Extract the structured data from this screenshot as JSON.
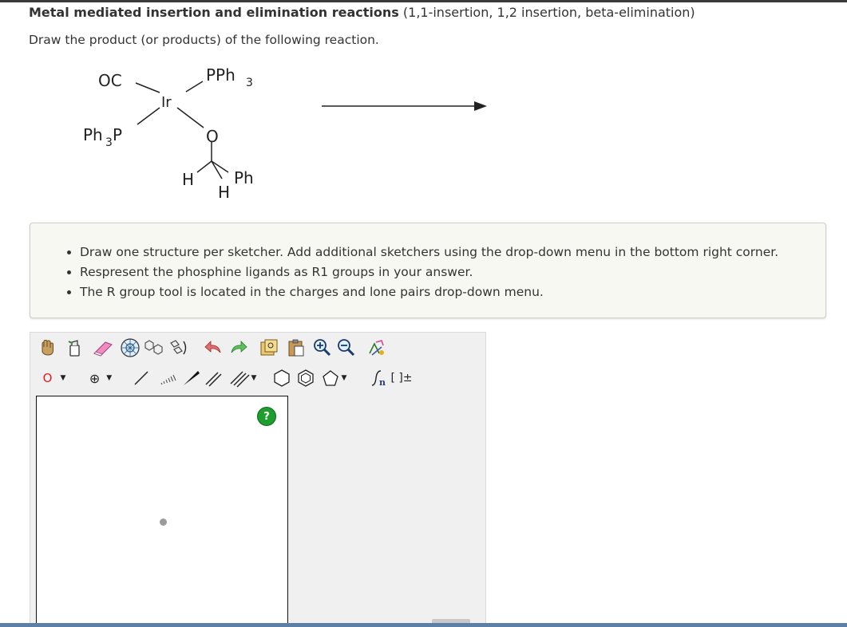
{
  "question": {
    "title_bold": "Metal mediated insertion and elimination reactions",
    "title_rest": " (1,1-insertion, 1,2 insertion, beta-elimination)",
    "instruction": "Draw the product (or products) of the following reaction."
  },
  "molecule": {
    "co": "OC",
    "pph3_top": "PPh",
    "pph3_top_sub": "3",
    "ir": "Ir",
    "ph3p_left": "Ph",
    "ph3p_left_sub": "3",
    "ph3p_left_p": "P",
    "oxygen": "O",
    "h_left": "H",
    "h_bottom": "H",
    "ph": "Ph"
  },
  "info": {
    "bullets": [
      "Draw one structure per sketcher. Add additional sketchers using the drop-down menu in the bottom right corner.",
      "Respresent the phosphine ligands as R1 groups in your answer.",
      "The R group tool is located in the charges and lone pairs drop-down menu."
    ]
  },
  "sketcher": {
    "atom_tool_label": "O",
    "charge_tool_label": "⊕",
    "help_label": "?",
    "sgroup_label": "[ ]±",
    "icons": [
      "hand-icon",
      "erase-icon",
      "eraser-icon",
      "template-icon",
      "ring-template-icon",
      "undo-icon",
      "redo-icon",
      "copy-icon",
      "paste-icon",
      "zoom-in-icon",
      "zoom-out-icon",
      "clean-icon"
    ],
    "colors": {
      "help": "#1f9d2e",
      "atom_label": "#e02020",
      "accent_border": "#5b7fa6"
    }
  }
}
